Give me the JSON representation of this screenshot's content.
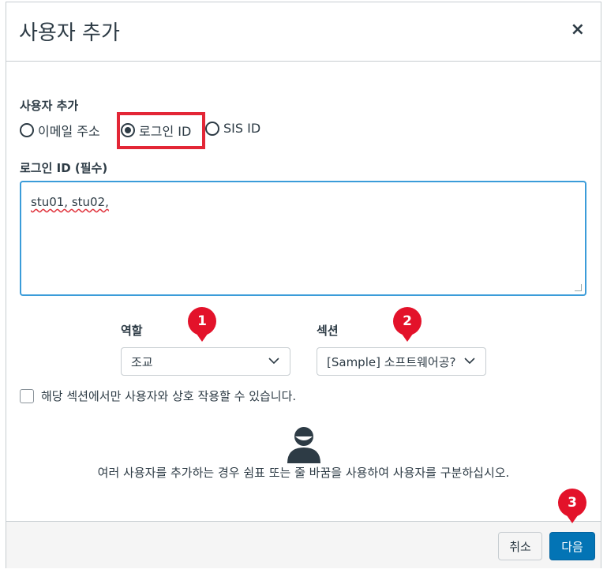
{
  "dialog": {
    "title": "사용자 추가",
    "close_icon": "close-icon",
    "close_glyph": "×"
  },
  "add_by": {
    "label": "사용자 추가",
    "options": [
      {
        "label": "이메일 주소",
        "checked": false
      },
      {
        "label": "로그인 ID",
        "checked": true
      },
      {
        "label": "SIS ID",
        "checked": false
      }
    ]
  },
  "login_field": {
    "label": "로그인 ID (필수)",
    "value": "stu01, stu02,"
  },
  "role": {
    "label": "역할",
    "selected": "조교"
  },
  "section": {
    "label": "섹션",
    "selected": "[Sample] 소프트웨어공?"
  },
  "restrict_checkbox": {
    "label": "해당 섹션에서만 사용자와 상호 작용할 수 있습니다.",
    "checked": false
  },
  "hint_text": "여러 사용자를 추가하는 경우 쉼표 또는 줄 바꿈을 사용하여 사용자를 구분하십시오.",
  "footer": {
    "cancel_label": "취소",
    "next_label": "다음"
  },
  "badges": [
    "1",
    "2",
    "3"
  ],
  "colors": {
    "accent": "#0374b5",
    "badge": "#e3122a",
    "highlight": "#e32636",
    "focus": "#3b9cd9"
  }
}
